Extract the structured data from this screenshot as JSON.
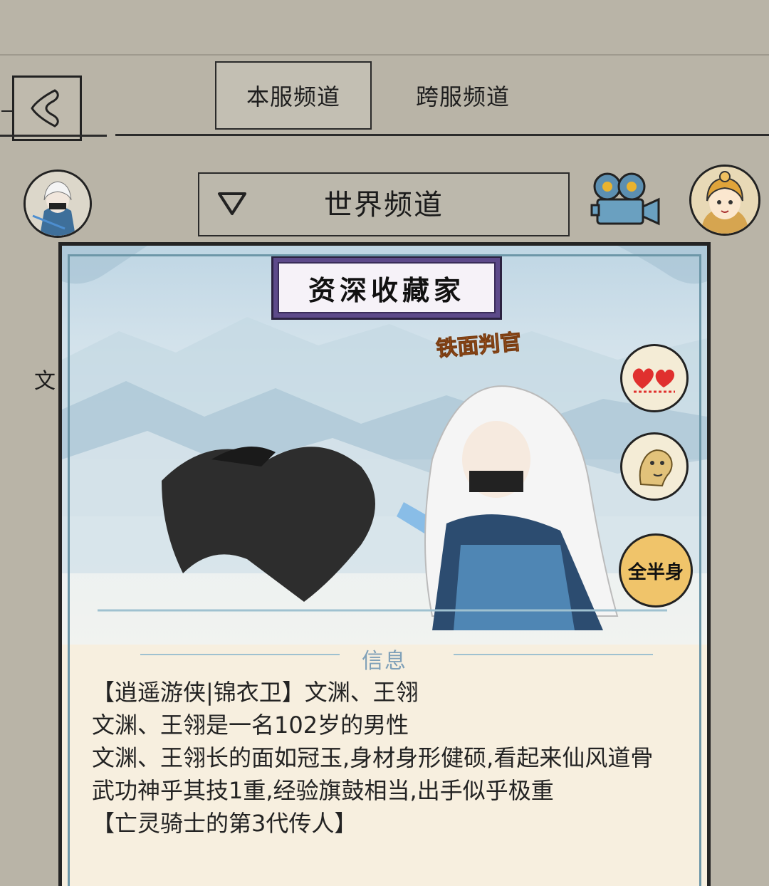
{
  "header": {
    "tabs": [
      {
        "label": "本服频道",
        "active": true
      },
      {
        "label": "跨服频道",
        "active": false
      }
    ]
  },
  "channel": {
    "selected": "世界频道"
  },
  "side": {
    "text": "文"
  },
  "card": {
    "plaque": "资深收藏家",
    "badge": "铁面判官",
    "actions": {
      "view_toggle": "全半身"
    },
    "info": {
      "title": "信息",
      "lines": [
        "【逍遥游侠|锦衣卫】文渊、王翎",
        "文渊、王翎是一名102岁的男性",
        "文渊、王翎长的面如冠玉,身材身形健硕,看起来仙风道骨",
        "武功神乎其技1重,经验旗鼓相当,出手似乎极重",
        "【亡灵骑士的第3代传人】"
      ]
    }
  },
  "colors": {
    "background": "#b9b4a7",
    "card_border": "#6d97a8",
    "plaque": "#5d4a8a",
    "badge": "#e87f34"
  }
}
